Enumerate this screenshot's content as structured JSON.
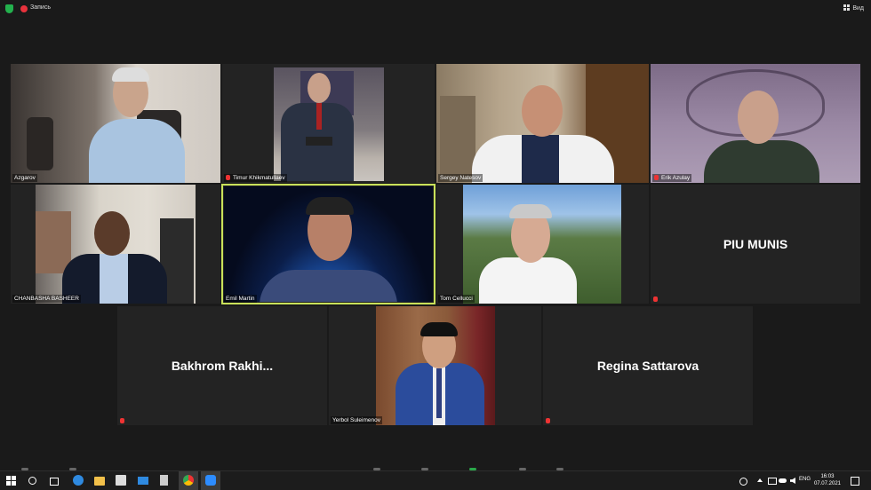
{
  "topbar": {
    "recording_label": "Запись",
    "view_label": "Вид"
  },
  "tiles": [
    {
      "name": "Azgarov",
      "muted": false
    },
    {
      "name": "Timur Khikmatullaev",
      "muted": true
    },
    {
      "name": "Sergey Natesov",
      "muted": false
    },
    {
      "name": "Erik Azulay",
      "muted": true
    },
    {
      "name": "CHANBASHA BASHEER",
      "muted": false
    },
    {
      "name": "Emil Martin",
      "muted": false,
      "active": true
    },
    {
      "name": "Tom Cellucci",
      "muted": false
    },
    {
      "name": "PIU MUNIS",
      "video": false,
      "muted": true
    },
    {
      "name": "Bakhrom  Rakhi...",
      "video": false,
      "muted": true
    },
    {
      "name": "Yerbol Suleimenov",
      "muted": false
    },
    {
      "name": "Regina Sattarova",
      "video": false,
      "muted": true
    }
  ],
  "taskbar": {
    "language": "ENG",
    "time": "16:03",
    "date": "07.07.2021",
    "apps": [
      "windows-start",
      "search",
      "task-view",
      "edge",
      "file-explorer",
      "store",
      "mail",
      "calculator",
      "chrome",
      "zoom"
    ]
  },
  "colors": {
    "active_speaker": "#c9e15a",
    "mute": "#e33333",
    "background": "#1a1a1a",
    "tile": "#232323"
  }
}
